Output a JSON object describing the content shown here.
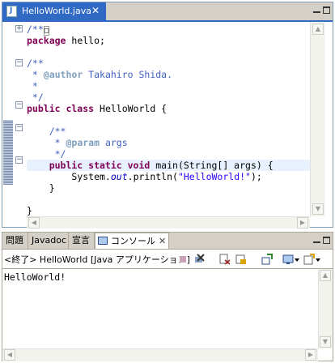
{
  "editor": {
    "tab_label": "HelloWorld.java",
    "close_glyph": "✕",
    "lines": [
      {
        "text": "/**",
        "extra": "□"
      },
      {
        "kw": "package",
        "rest": " hello;"
      },
      {
        "cm": "/**"
      },
      {
        "cm": " * ",
        "tag": "@author",
        "cm2": " Takahiro Shida."
      },
      {
        "cm": " *"
      },
      {
        "cm": " */"
      },
      {
        "kw": "public class",
        "rest": " HelloWorld {"
      },
      {
        "cm": "    /**"
      },
      {
        "cm": "     * ",
        "tag": "@param",
        "cm2": " args"
      },
      {
        "cm": "     */"
      },
      {
        "kw": "    public static void",
        "rest": " main(String[] args) {"
      },
      {
        "pre": "        System.",
        "it": "out",
        "post": ".println(",
        "str": "\"HelloWorld!\"",
        "end": ");"
      },
      {
        "rest": "    }"
      },
      {
        "rest": "}"
      }
    ]
  },
  "console": {
    "tabs": [
      "問題",
      "Javadoc",
      "宣言"
    ],
    "active_tab": "コンソール",
    "active_close": "✕",
    "title": "<終了> HelloWorld [Java アプリケーション]",
    "output": "HelloWorld!"
  },
  "colors": {
    "active_tab": "#316ac5",
    "keyword": "#7f0055",
    "comment": "#3f5fbf",
    "string": "#2a00ff",
    "current_line": "#e8f2fe"
  }
}
